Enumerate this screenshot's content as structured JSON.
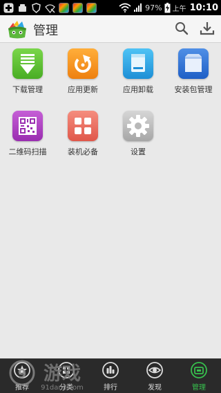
{
  "status_bar": {
    "battery_percent": "97%",
    "noon": "上午",
    "time": "10:10"
  },
  "header": {
    "title": "管理"
  },
  "apps": [
    {
      "label": "下载管理",
      "icon": "download-manager-icon",
      "color": "#5cc433"
    },
    {
      "label": "应用更新",
      "icon": "app-update-icon",
      "color": "#f6921e"
    },
    {
      "label": "应用卸载",
      "icon": "app-uninstall-icon",
      "color": "#2ea7e6"
    },
    {
      "label": "安装包管理",
      "icon": "package-manager-icon",
      "color": "#2b6fd6"
    },
    {
      "label": "二维码扫描",
      "icon": "qr-scan-icon",
      "color": "#b43fc4"
    },
    {
      "label": "装机必备",
      "icon": "essentials-icon",
      "color": "#ec6f5e"
    },
    {
      "label": "设置",
      "icon": "settings-gear-icon",
      "color": "#b8b8b8"
    }
  ],
  "tabs": [
    {
      "label": "推荐",
      "icon": "recommend-icon",
      "active": false
    },
    {
      "label": "分类",
      "icon": "category-icon",
      "active": false
    },
    {
      "label": "排行",
      "icon": "ranking-icon",
      "active": false
    },
    {
      "label": "发现",
      "icon": "discover-eye-icon",
      "active": false
    },
    {
      "label": "管理",
      "icon": "manage-icon",
      "active": true
    }
  ],
  "watermark": {
    "text": "游戏",
    "subtext": "91danji.com"
  },
  "colors": {
    "accent_green": "#37c04d",
    "tab_bar": "#2a2a2a",
    "background": "#e9e9e9"
  }
}
